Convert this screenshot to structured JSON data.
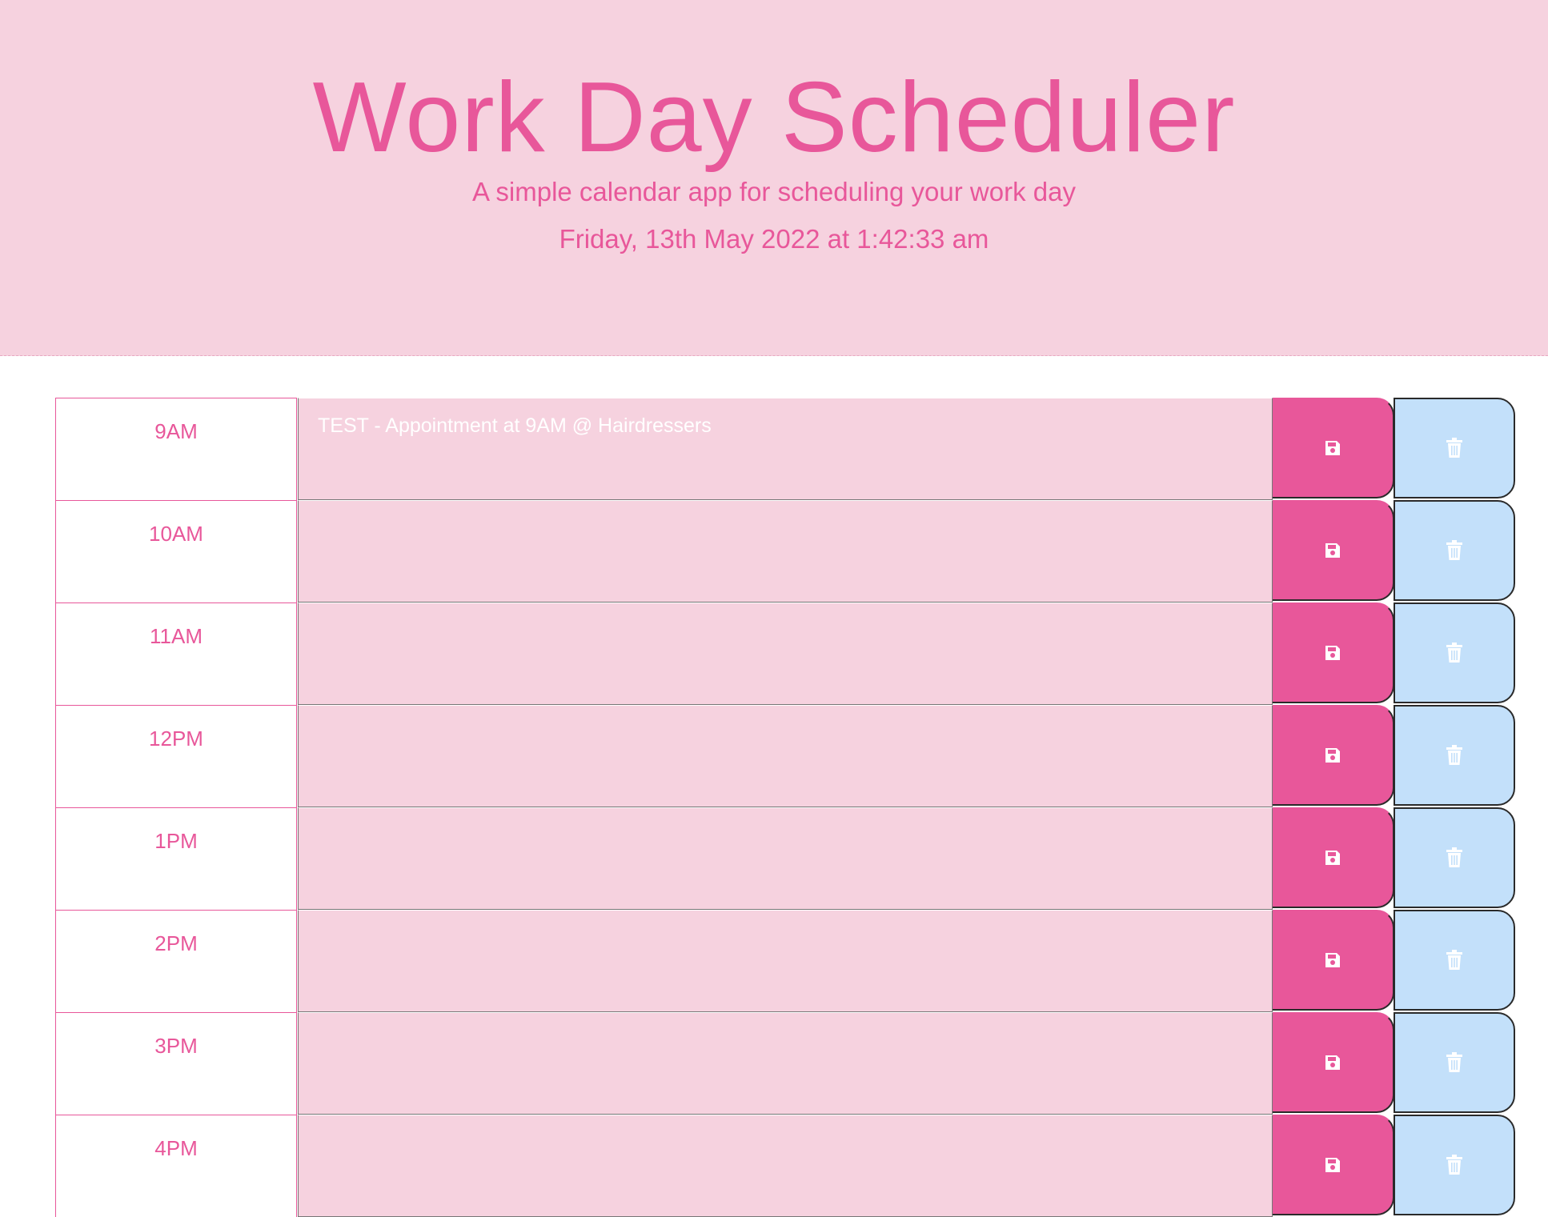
{
  "header": {
    "title": "Work Day Scheduler",
    "subtitle": "A simple calendar app for scheduling your work day",
    "current_day": "Friday, 13th May 2022 at 1:42:33 am"
  },
  "colors": {
    "accent": "#e8579a",
    "header_bg": "#f6d2df",
    "delete_bg": "#c3e0fa"
  },
  "schedule": {
    "blocks": [
      {
        "hour": "9AM",
        "text": "TEST - Appointment at 9AM @ Hairdressers"
      },
      {
        "hour": "10AM",
        "text": ""
      },
      {
        "hour": "11AM",
        "text": ""
      },
      {
        "hour": "12PM",
        "text": ""
      },
      {
        "hour": "1PM",
        "text": ""
      },
      {
        "hour": "2PM",
        "text": ""
      },
      {
        "hour": "3PM",
        "text": ""
      },
      {
        "hour": "4PM",
        "text": ""
      }
    ],
    "save_icon": "floppy-disk-icon",
    "delete_icon": "trash-icon"
  }
}
